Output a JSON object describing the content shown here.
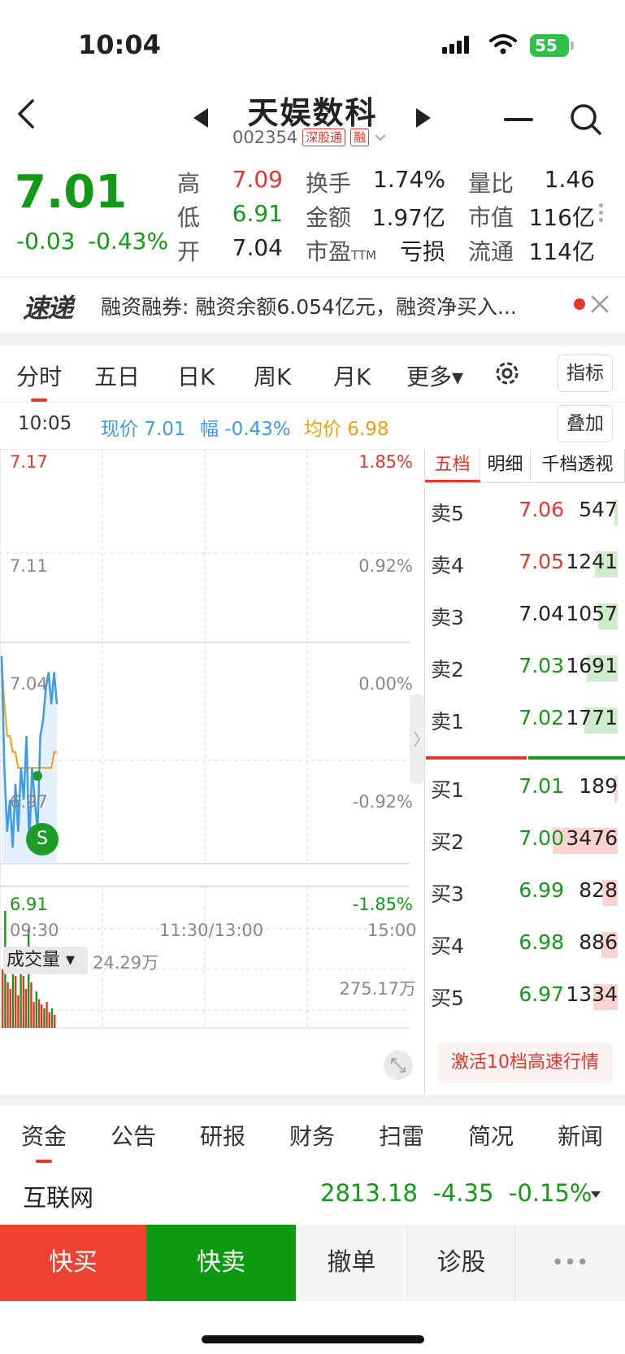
{
  "status_bar": {
    "time": "10:04",
    "battery": "55"
  },
  "header": {
    "name": "天娱数科",
    "code": "002354",
    "tag1": "深股通",
    "tag2": "融",
    "prev_icon": "triangle-left-icon",
    "next_icon": "triangle-right-icon"
  },
  "quote": {
    "price": "7.01",
    "change": "-0.03",
    "change_pct": "-0.43%",
    "stats": [
      {
        "label": "高",
        "value": "7.09"
      },
      {
        "label": "低",
        "value": "6.91"
      },
      {
        "label": "开",
        "value": "7.04"
      },
      {
        "label": "换手",
        "value": "1.74%"
      },
      {
        "label": "金额",
        "value": "1.97亿"
      },
      {
        "label": "市盈",
        "label_sub": "TTM",
        "value": "亏损"
      },
      {
        "label": "量比",
        "value": "1.46"
      },
      {
        "label": "市值",
        "value": "116亿"
      },
      {
        "label": "流通",
        "value": "114亿"
      }
    ]
  },
  "news": {
    "logo": "速递",
    "text": "融资融券: 融资余额6.054亿元，融资净买入..."
  },
  "chart_tabs": [
    "分时",
    "五日",
    "日K",
    "周K",
    "月K",
    "更多▾"
  ],
  "buttons": {
    "indicator": "指标",
    "overlay": "叠加"
  },
  "info_line": {
    "time": "10:05",
    "now": "现价 7.01",
    "amp": "幅 -0.43%",
    "avg": "均价 6.98"
  },
  "chart_data": {
    "type": "line",
    "series": [
      {
        "values": [
          7.04,
          6.97,
          6.93,
          6.95,
          6.92,
          6.96,
          6.93,
          6.97,
          6.95,
          6.99,
          6.92,
          6.97,
          6.95,
          6.93,
          6.99,
          7.0,
          7.02,
          7.03,
          7.01,
          7.03,
          7.01
        ],
        "color": "#3d9be9"
      },
      {
        "values": [
          7.04,
          7.01,
          6.99,
          6.99,
          6.98,
          6.98,
          6.97,
          6.97,
          6.97,
          6.97,
          6.97,
          6.97,
          6.97,
          6.97,
          6.97,
          6.97,
          6.97,
          6.97,
          6.97,
          6.98,
          6.98
        ],
        "color": "#f39c12"
      }
    ],
    "ylim": [
      6.91,
      7.17
    ],
    "y_left_ticks": [
      "7.17",
      "7.11",
      "7.04",
      "6.97",
      "6.91"
    ],
    "y_right_ticks": [
      "1.85%",
      "0.92%",
      "0.00%",
      "-0.92%",
      "-1.85%"
    ],
    "x_ticks": [
      "09:30",
      "11:30/13:00",
      "15:00"
    ],
    "marker": "S",
    "volume_label": "成交量 ▾",
    "volume_now": "24.29万",
    "volume_max": "275.17万",
    "volume": [
      0.45,
      0.9,
      0.35,
      0.3,
      0.5,
      0.4,
      0.25,
      0.55,
      0.4,
      0.3,
      0.75,
      0.35,
      0.2,
      0.28,
      0.22,
      0.18,
      0.15,
      0.2,
      0.12,
      0.15,
      0.1
    ]
  },
  "orderbook": {
    "tabs": [
      "五档",
      "明细",
      "千档透视"
    ],
    "asks": [
      {
        "label": "卖5",
        "price": "7.06",
        "vol": "547",
        "bar": 0.05
      },
      {
        "label": "卖4",
        "price": "7.05",
        "vol": "1241",
        "bar": 0.35
      },
      {
        "label": "卖3",
        "price": "7.04",
        "vol": "1057",
        "bar": 0.3
      },
      {
        "label": "卖2",
        "price": "7.03",
        "vol": "1691",
        "bar": 0.48
      },
      {
        "label": "卖1",
        "price": "7.02",
        "vol": "1771",
        "bar": 0.51
      }
    ],
    "bids": [
      {
        "label": "买1",
        "price": "7.01",
        "vol": "189",
        "bar": 0.05
      },
      {
        "label": "买2",
        "price": "7.00",
        "vol": "3476",
        "bar": 1.0
      },
      {
        "label": "买3",
        "price": "6.99",
        "vol": "828",
        "bar": 0.24
      },
      {
        "label": "买4",
        "price": "6.98",
        "vol": "886",
        "bar": 0.25
      },
      {
        "label": "买5",
        "price": "6.97",
        "vol": "1334",
        "bar": 0.38
      }
    ],
    "activate": "激活10档高速行情"
  },
  "bottom_tabs": [
    "资金",
    "公告",
    "研报",
    "财务",
    "扫雷",
    "简况",
    "新闻"
  ],
  "sector": {
    "name": "互联网",
    "value": "2813.18",
    "change": "-4.35",
    "pct": "-0.15%"
  },
  "actions": {
    "buy": "快买",
    "sell": "快卖",
    "cancel": "撤单",
    "diagnose": "诊股",
    "more": "•••"
  },
  "colors": {
    "up": "#e8352b",
    "down": "#129a16",
    "price_line": "#3d9be9",
    "avg_line": "#f39c12"
  }
}
